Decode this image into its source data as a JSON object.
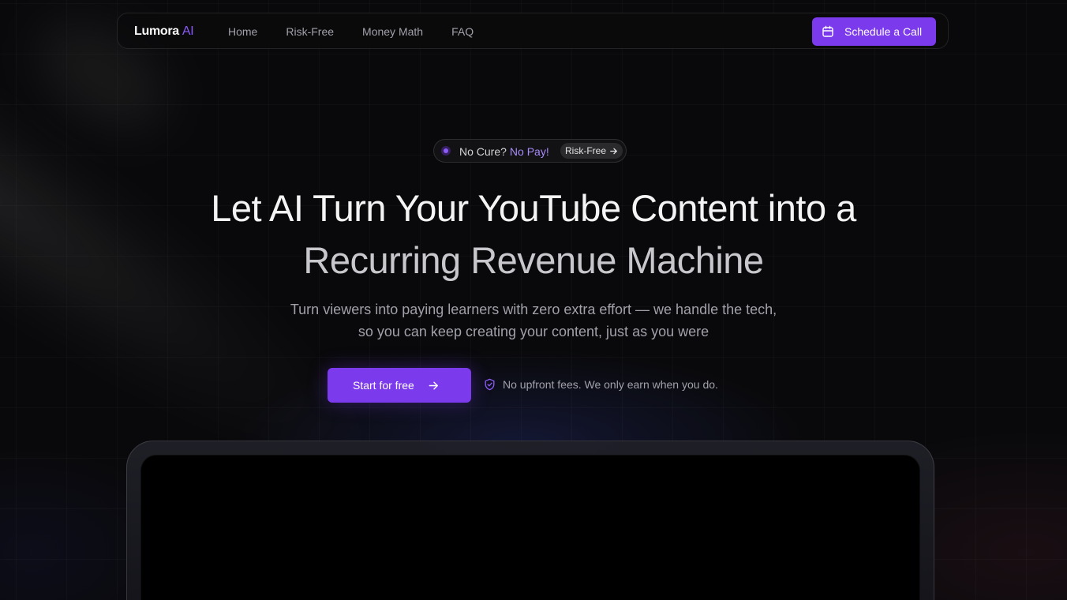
{
  "nav": {
    "logo_main": "Lumora",
    "logo_accent": "AI",
    "links": [
      "Home",
      "Risk-Free",
      "Money Math",
      "FAQ"
    ],
    "cta_label": "Schedule a Call",
    "cta_icon": "calendar-icon"
  },
  "badge": {
    "text": "No Cure?",
    "accent": "No Pay!",
    "pill_label": "Risk-Free",
    "pill_icon": "arrow-right-icon"
  },
  "hero": {
    "headline_line1": "Let AI Turn Your YouTube Content into a",
    "headline_line2": "Recurring Revenue Machine",
    "subtitle_line1": "Turn viewers into paying learners with zero extra effort — we handle the tech,",
    "subtitle_line2": "so you can keep creating your content, just as you were",
    "primary_button": "Start for free",
    "primary_icon": "arrow-right-icon",
    "guarantee_icon": "shield-check-icon",
    "guarantee_text": "No upfront fees. We only earn when you do."
  },
  "colors": {
    "background": "#09090b",
    "accent": "#7c3aed",
    "accent_light": "#a78bfa"
  }
}
